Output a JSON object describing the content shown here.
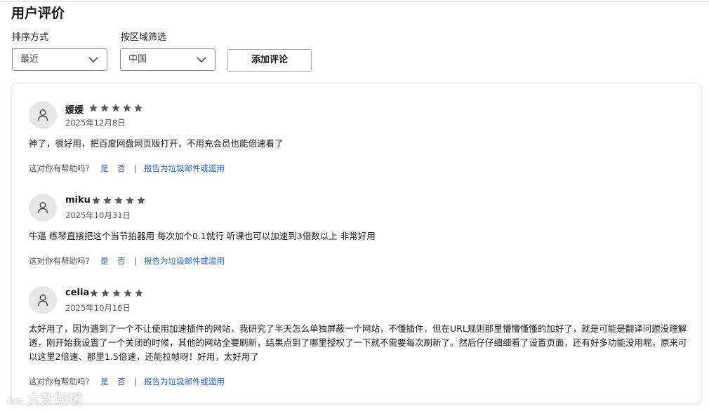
{
  "page": {
    "title": "用户评价"
  },
  "filters": {
    "sort_label": "排序方式",
    "sort_value": "最近",
    "region_label": "按区域筛选",
    "region_value": "中国",
    "add_review_label": "添加评论"
  },
  "reviews": [
    {
      "name": "媛媛",
      "rating": 5,
      "date": "2025年12月8日",
      "text": "神了，很好用，把百度网盘网页版打开，不用充会员也能倍速看了",
      "helpful_prompt": "这对你有帮助吗?",
      "yes": "是",
      "no": "否",
      "divider": "|",
      "report": "报告为垃圾邮件或滥用"
    },
    {
      "name": "miku",
      "rating": 5,
      "date": "2025年10月31日",
      "text": "牛逼 练琴直接把这个当节拍器用 每次加个0.1就行 听课也可以加速到3倍数以上 非常好用",
      "helpful_prompt": "这对你有帮助吗?",
      "yes": "是",
      "no": "否",
      "divider": "|",
      "report": "报告为垃圾邮件或滥用"
    },
    {
      "name": "celia",
      "rating": 5,
      "date": "2025年10月16日",
      "text": "太好用了，因为遇到了一个不让使用加速插件的网站，我研究了半天怎么单独屏蔽一个网站，不懂插件，但在URL规则那里懵懵懂懂的加好了，就是可能是翻译问题没理解透，刚开始我设置了一个关闭的时候，其他的网站全要刷新，结果点到了哪里授权了一下就不需要每次刷新了。然后仔仔细细看了设置页面，还有好多功能没用呢，原来可以这里2倍速、那里1.5倍速，还能拉帧呀！好用，太好用了",
      "helpful_prompt": "这对你有帮助吗?",
      "yes": "是",
      "no": "否",
      "divider": "|",
      "report": "报告为垃圾邮件或滥用"
    }
  ],
  "watermark": {
    "text": "大数跨境"
  },
  "colors": {
    "link": "#2860b7",
    "star": "#5a5a5a",
    "avatar_bg": "#e6e6e6"
  }
}
